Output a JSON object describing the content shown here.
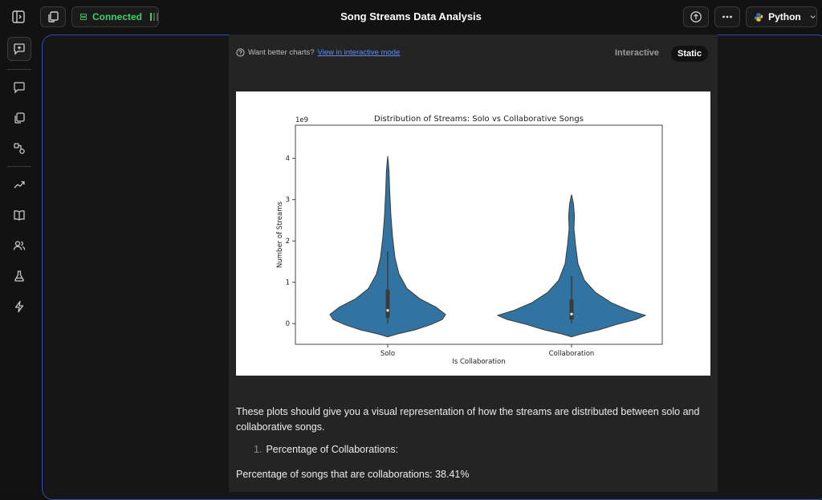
{
  "header": {
    "title": "Song Streams Data Analysis",
    "connection_status": "Connected",
    "language": "Python"
  },
  "sidebar": {
    "items": [
      {
        "icon": "panel-toggle-icon"
      },
      {
        "icon": "new-chat-icon"
      },
      {
        "icon": "chat-icon"
      },
      {
        "icon": "copy-icon"
      },
      {
        "icon": "shapes-icon"
      },
      {
        "icon": "trend-icon"
      },
      {
        "icon": "book-icon"
      },
      {
        "icon": "users-icon"
      },
      {
        "icon": "flask-icon"
      },
      {
        "icon": "bolt-icon"
      }
    ]
  },
  "output": {
    "hint_text": "Want better charts?",
    "hint_link": "View in interactive mode",
    "toggle_interactive": "Interactive",
    "toggle_static": "Static"
  },
  "chart_data": {
    "type": "violin",
    "title": "Distribution of Streams: Solo vs Collaborative Songs",
    "xlabel": "Is Collaboration",
    "ylabel": "Number of Streams",
    "offset_label": "1e9",
    "categories": [
      "Solo",
      "Collaboration"
    ],
    "yticks": [
      0,
      1,
      2,
      3,
      4
    ],
    "ylim": [
      -0.5,
      4.8
    ],
    "fill_color": "#3274a1",
    "series": [
      {
        "category": "Solo",
        "min": 0.0,
        "q1": 0.14,
        "median": 0.32,
        "q3": 0.82,
        "whisker_high": 1.75,
        "max": 4.05
      },
      {
        "category": "Collaboration",
        "min": 0.0,
        "q1": 0.1,
        "median": 0.23,
        "q3": 0.58,
        "whisker_high": 1.15,
        "max": 3.12
      }
    ]
  },
  "text": {
    "paragraph": "These plots should give you a visual representation of how the streams are distributed between solo and collaborative songs.",
    "list_number": "1.",
    "list_item": "Percentage of Collaborations:",
    "percentage_line": "Percentage of songs that are collaborations: 38.41%"
  }
}
